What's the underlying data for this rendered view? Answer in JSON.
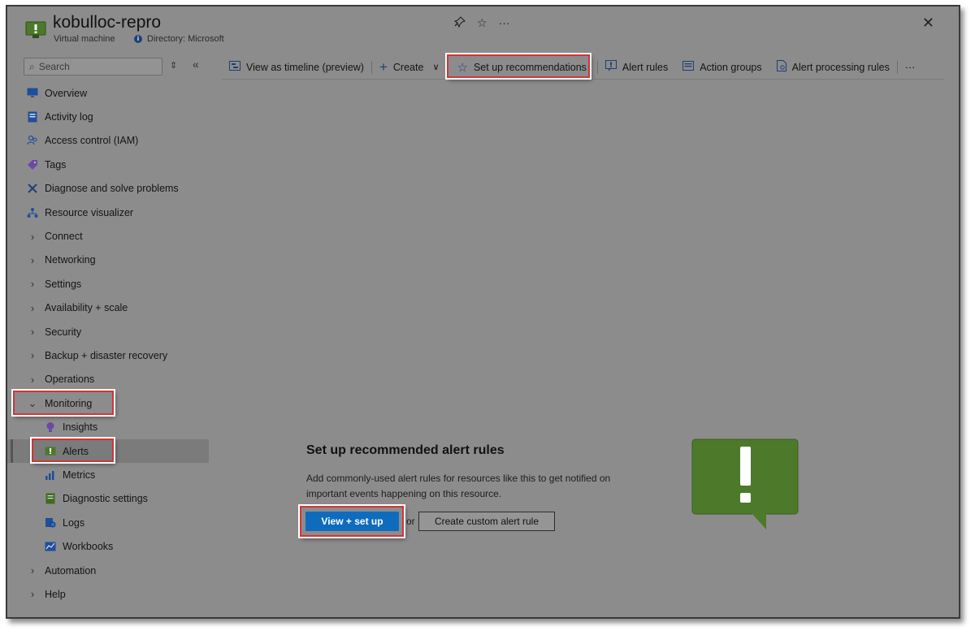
{
  "header": {
    "title": "kobulloc-repro",
    "subtitle": "Virtual machine",
    "directory": "Directory: Microsoft"
  },
  "sidebar": {
    "search_placeholder": "Search",
    "items": [
      {
        "label": "Overview",
        "icon": "monitor-icon"
      },
      {
        "label": "Activity log",
        "icon": "log-icon"
      },
      {
        "label": "Access control (IAM)",
        "icon": "people-icon"
      },
      {
        "label": "Tags",
        "icon": "tag-icon"
      },
      {
        "label": "Diagnose and solve problems",
        "icon": "wrench-icon"
      },
      {
        "label": "Resource visualizer",
        "icon": "hierarchy-icon"
      },
      {
        "label": "Connect"
      },
      {
        "label": "Networking"
      },
      {
        "label": "Settings"
      },
      {
        "label": "Availability + scale"
      },
      {
        "label": "Security"
      },
      {
        "label": "Backup + disaster recovery"
      },
      {
        "label": "Operations"
      },
      {
        "label": "Monitoring"
      },
      {
        "label": "Insights",
        "icon": "insights-icon"
      },
      {
        "label": "Alerts",
        "icon": "alerts-icon"
      },
      {
        "label": "Metrics",
        "icon": "metrics-icon"
      },
      {
        "label": "Diagnostic settings",
        "icon": "diagnostic-settings-icon"
      },
      {
        "label": "Logs",
        "icon": "logs-icon"
      },
      {
        "label": "Workbooks",
        "icon": "workbooks-icon"
      },
      {
        "label": "Automation"
      },
      {
        "label": "Help"
      }
    ]
  },
  "toolbar": {
    "timeline": "View as timeline (preview)",
    "create": "Create",
    "recommendations": "Set up recommendations",
    "alert_rules": "Alert rules",
    "action_groups": "Action groups",
    "processing_rules": "Alert processing rules",
    "more": "···"
  },
  "empty_state": {
    "title": "Set up recommended alert rules",
    "description": "Add commonly-used alert rules for resources like this to get notified on important events happening on this resource.",
    "primary_button": "View + set up",
    "or_text": "or",
    "secondary_button": "Create custom alert rule"
  },
  "colors": {
    "highlight": "#d13438",
    "primary": "#0f6cbd",
    "alert_green": "#4d7a2a"
  }
}
